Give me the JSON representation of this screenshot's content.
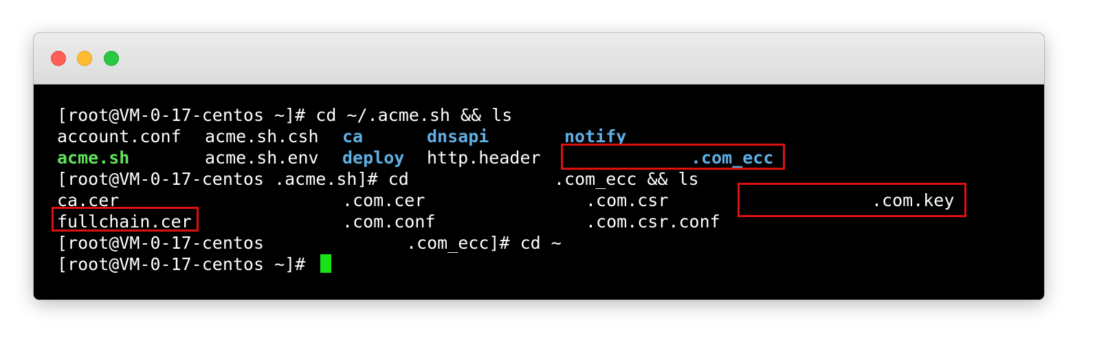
{
  "window": {
    "traffic_lights": [
      "close",
      "minimize",
      "zoom"
    ]
  },
  "terminal": {
    "lines": [
      {
        "tokens": [
          {
            "text": "[root@VM-0-17-centos ~]# cd ~/.acme.sh && ls",
            "style": "plain"
          }
        ]
      },
      {
        "tokens": [
          {
            "text": "account.conf",
            "style": "plain"
          },
          {
            "text": "acme.sh.csh",
            "style": "plain"
          },
          {
            "text": "ca",
            "style": "dir"
          },
          {
            "text": "dnsapi",
            "style": "dir"
          },
          {
            "text": "notify",
            "style": "dir"
          }
        ]
      },
      {
        "tokens": [
          {
            "text": "acme.sh",
            "style": "exec"
          },
          {
            "text": "acme.sh.env",
            "style": "plain"
          },
          {
            "text": "deploy",
            "style": "dir"
          },
          {
            "text": "http.header",
            "style": "plain"
          },
          {
            "text": ".com_ecc",
            "style": "dir"
          }
        ]
      },
      {
        "tokens": [
          {
            "text": "[root@VM-0-17-centos .acme.sh]# cd",
            "style": "plain"
          },
          {
            "text": ".com_ecc && ls",
            "style": "plain"
          }
        ]
      },
      {
        "tokens": [
          {
            "text": "ca.cer",
            "style": "plain"
          },
          {
            "text": ".com.cer",
            "style": "plain"
          },
          {
            "text": ".com.csr",
            "style": "plain"
          },
          {
            "text": ".com.key",
            "style": "plain"
          }
        ]
      },
      {
        "tokens": [
          {
            "text": "fullchain.cer",
            "style": "plain"
          },
          {
            "text": ".com.conf",
            "style": "plain"
          },
          {
            "text": ".com.csr.conf",
            "style": "plain"
          }
        ]
      },
      {
        "tokens": [
          {
            "text": "[root@VM-0-17-centos",
            "style": "plain"
          },
          {
            "text": ".com_ecc]# cd ~",
            "style": "plain"
          }
        ]
      },
      {
        "tokens": [
          {
            "text": "[root@VM-0-17-centos ~]#",
            "style": "plain"
          }
        ]
      }
    ]
  },
  "colors": {
    "background": "#000000",
    "text": "#ffffff",
    "directory": "#5fafe6",
    "executable": "#62e35c",
    "cursor": "#19e219",
    "highlight": "#e01010"
  }
}
